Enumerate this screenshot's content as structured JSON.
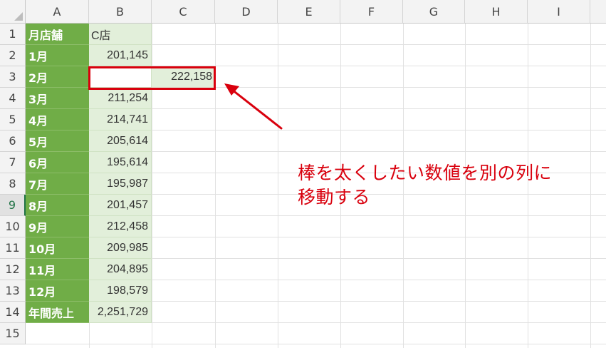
{
  "columns": [
    "A",
    "B",
    "C",
    "D",
    "E",
    "F",
    "G",
    "H",
    "I"
  ],
  "rows": [
    "1",
    "2",
    "3",
    "4",
    "5",
    "6",
    "7",
    "8",
    "9",
    "10",
    "11",
    "12",
    "13",
    "14",
    "15"
  ],
  "table": {
    "header": {
      "label": "月店舗",
      "store": "C店"
    },
    "records": [
      {
        "label": "1月",
        "value": "201,145"
      },
      {
        "label": "2月",
        "value": ""
      },
      {
        "label": "3月",
        "value": "211,254"
      },
      {
        "label": "4月",
        "value": "214,741"
      },
      {
        "label": "5月",
        "value": "205,614"
      },
      {
        "label": "6月",
        "value": "195,614"
      },
      {
        "label": "7月",
        "value": "195,987"
      },
      {
        "label": "8月",
        "value": "201,457"
      },
      {
        "label": "9月",
        "value": "212,458"
      },
      {
        "label": "10月",
        "value": "209,985"
      },
      {
        "label": "11月",
        "value": "204,895"
      },
      {
        "label": "12月",
        "value": "198,579"
      },
      {
        "label": "年間売上",
        "value": "2,251,729"
      }
    ],
    "moved_value": "222,158"
  },
  "annotation": {
    "line1": "棒を太くしたい数値を別の列に",
    "line2": "移動する"
  },
  "colors": {
    "label_fill": "#70ad47",
    "value_fill": "#e2efda",
    "annotation": "#d9000d",
    "selected_row_header": "#217346"
  }
}
